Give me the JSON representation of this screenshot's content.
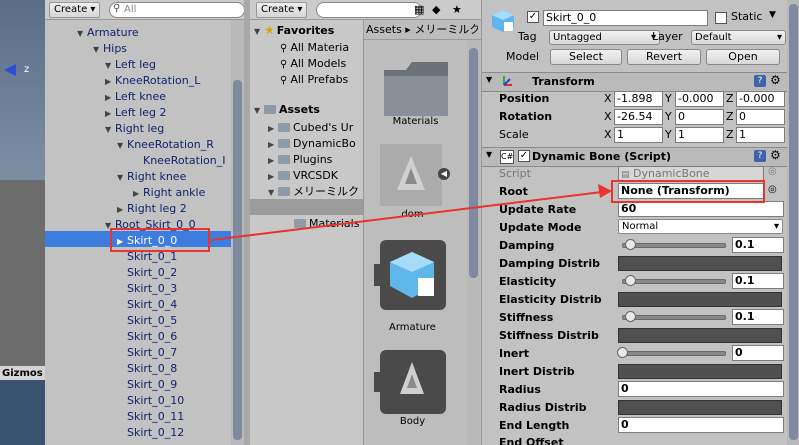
{
  "scene": {
    "axis_label": "z",
    "gizmos_label": "Gizmos"
  },
  "hierarchy": {
    "create_label": "Create",
    "search_placeholder": "All",
    "items": [
      {
        "label": "Armature",
        "arrow": "▼"
      },
      {
        "label": "Hips",
        "arrow": "▼"
      },
      {
        "label": "Left leg",
        "arrow": "▼"
      },
      {
        "label": "KneeRotation_L",
        "arrow": "▶"
      },
      {
        "label": "Left knee",
        "arrow": "▶"
      },
      {
        "label": "Left leg 2",
        "arrow": "▶"
      },
      {
        "label": "Right leg",
        "arrow": "▼"
      },
      {
        "label": "KneeRotation_R",
        "arrow": "▼"
      },
      {
        "label": "KneeRotation_I",
        "arrow": ""
      },
      {
        "label": "Right knee",
        "arrow": "▼"
      },
      {
        "label": "Right ankle",
        "arrow": "▶"
      },
      {
        "label": "Right leg 2",
        "arrow": "▶"
      },
      {
        "label": "Root_Skirt_0_0",
        "arrow": "▼"
      },
      {
        "label": "Skirt_0_0",
        "arrow": "▶"
      },
      {
        "label": "Skirt_0_1",
        "arrow": ""
      },
      {
        "label": "Skirt_0_2",
        "arrow": ""
      },
      {
        "label": "Skirt_0_3",
        "arrow": ""
      },
      {
        "label": "Skirt_0_4",
        "arrow": ""
      },
      {
        "label": "Skirt_0_5",
        "arrow": ""
      },
      {
        "label": "Skirt_0_6",
        "arrow": ""
      },
      {
        "label": "Skirt_0_7",
        "arrow": ""
      },
      {
        "label": "Skirt_0_8",
        "arrow": ""
      },
      {
        "label": "Skirt_0_9",
        "arrow": ""
      },
      {
        "label": "Skirt_0_10",
        "arrow": ""
      },
      {
        "label": "Skirt_0_11",
        "arrow": ""
      },
      {
        "label": "Skirt_0_12",
        "arrow": ""
      }
    ]
  },
  "project": {
    "create_label": "Create",
    "favorites_label": "Favorites",
    "favorites": [
      "All Materia",
      "All Models",
      "All Prefabs"
    ],
    "assets_label": "Assets",
    "assets": [
      "Cubed's Ur",
      "DynamicBo",
      "Plugins",
      "VRCSDK",
      "メリーミルク"
    ],
    "materials_sub": "Materials",
    "breadcrumb": "Assets ▸ メリーミルク",
    "grid": [
      "Materials",
      "dom",
      "Armature",
      "Body"
    ]
  },
  "inspector": {
    "object_name": "Skirt_0_0",
    "static_label": "Static",
    "tag_label": "Tag",
    "tag_value": "Untagged",
    "layer_label": "Layer",
    "layer_value": "Default",
    "model_label": "Model",
    "select_label": "Select",
    "revert_label": "Revert",
    "open_label": "Open",
    "transform_title": "Transform",
    "position_label": "Position",
    "position": {
      "x": "-1.898",
      "y": "-0.000",
      "z": "-0.000"
    },
    "rotation_label": "Rotation",
    "rotation": {
      "x": "-26.54",
      "y": "0",
      "z": "0"
    },
    "scale_label": "Scale",
    "scale": {
      "x": "1",
      "y": "1",
      "z": "1"
    },
    "axis_x": "X",
    "axis_y": "Y",
    "axis_z": "Z",
    "db_title": "Dynamic Bone (Script)",
    "script_label": "Script",
    "script_value": "DynamicBone",
    "root_label": "Root",
    "root_value": "None (Transform)",
    "update_rate_label": "Update Rate",
    "update_rate_value": "60",
    "update_mode_label": "Update Mode",
    "update_mode_value": "Normal",
    "damping_label": "Damping",
    "damping_value": "0.1",
    "damping_distrib_label": "Damping Distrib",
    "elasticity_label": "Elasticity",
    "elasticity_value": "0.1",
    "elasticity_distrib_label": "Elasticity Distrib",
    "stiffness_label": "Stiffness",
    "stiffness_value": "0.1",
    "stiffness_distrib_label": "Stiffness Distrib",
    "inert_label": "Inert",
    "inert_value": "0",
    "inert_distrib_label": "Inert Distrib",
    "radius_label": "Radius",
    "radius_value": "0",
    "radius_distrib_label": "Radius Distrib",
    "end_length_label": "End Length",
    "end_length_value": "0",
    "end_offset_label": "End Offset"
  },
  "colors": {
    "selection": "#3e7de0",
    "annotation": "#e8332e",
    "hier_text": "#11246b"
  }
}
